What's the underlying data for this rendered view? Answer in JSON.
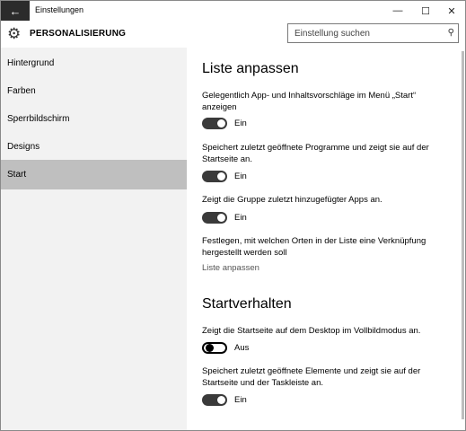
{
  "window": {
    "title": "Einstellungen"
  },
  "titlebar": {
    "back_glyph": "←",
    "min_glyph": "—",
    "max_glyph": "☐",
    "close_glyph": "✕"
  },
  "header": {
    "title": "PERSONALISIERUNG",
    "icon": "gear-icon",
    "search_placeholder": "Einstellung suchen",
    "search_icon_glyph": "⚲"
  },
  "sidebar": {
    "items": [
      {
        "label": "Hintergrund",
        "active": false
      },
      {
        "label": "Farben",
        "active": false
      },
      {
        "label": "Sperrbildschirm",
        "active": false
      },
      {
        "label": "Designs",
        "active": false
      },
      {
        "label": "Start",
        "active": true
      }
    ]
  },
  "content": {
    "section1": {
      "heading": "Liste anpassen",
      "settings": [
        {
          "text": "Gelegentlich App- und Inhaltsvorschläge im Menü „Start“ anzeigen",
          "state": "Ein",
          "on": true
        },
        {
          "text": "Speichert zuletzt geöffnete Programme und zeigt sie auf der Startseite an.",
          "state": "Ein",
          "on": true
        },
        {
          "text": "Zeigt die Gruppe zuletzt hinzugefügter Apps an.",
          "state": "Ein",
          "on": true
        }
      ],
      "folders_text": "Festlegen, mit welchen Orten in der Liste eine Verknüpfung hergestellt werden soll",
      "folders_link": "Liste anpassen"
    },
    "section2": {
      "heading": "Startverhalten",
      "settings": [
        {
          "text": "Zeigt die Startseite auf dem Desktop im Vollbildmodus an.",
          "state": "Aus",
          "on": false
        },
        {
          "text": "Speichert zuletzt geöffnete Elemente und zeigt sie auf der Startseite und der Taskleiste an.",
          "state": "Ein",
          "on": true
        }
      ]
    }
  },
  "colors": {
    "sidebar_bg": "#f2f2f2",
    "active_item_bg": "#bfbfbf",
    "toggle_on": "#3a3a3a",
    "back_button_bg": "#2b2b2b"
  }
}
